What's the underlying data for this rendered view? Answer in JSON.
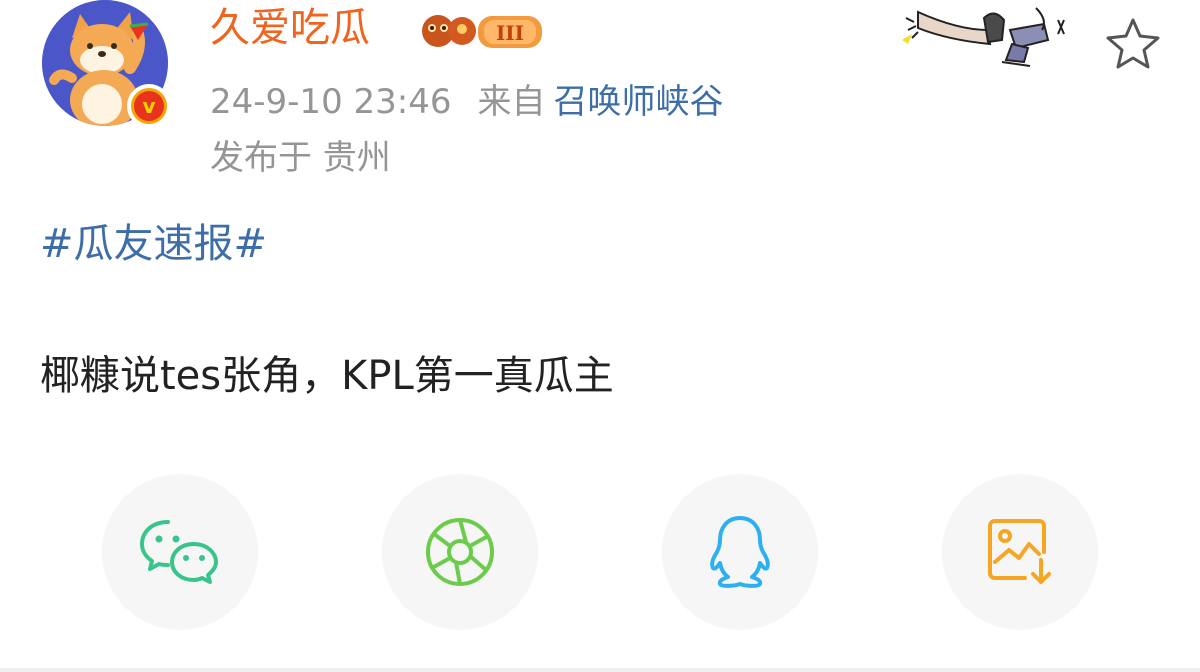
{
  "post": {
    "username": "久爱吃瓜",
    "timestamp": "24-9-10 23:46",
    "source_label": "来自",
    "source": "召唤师峡谷",
    "location": "发布于 贵州",
    "hashtag": "#瓜友速报#",
    "text": "椰糠说tes张角，KPL第一真瓜主"
  },
  "share_buttons": [
    {
      "icon": "wechat-icon",
      "color": "#38c48a"
    },
    {
      "icon": "moments-aperture-icon",
      "color": "#6ccb4a"
    },
    {
      "icon": "qq-icon",
      "color": "#2eb0f0"
    },
    {
      "icon": "save-image-icon",
      "color": "#f5a623"
    }
  ],
  "colors": {
    "username": "#f0641e",
    "link": "#3d6ea8",
    "meta": "#959595",
    "text": "#222222",
    "avatar_bg": "#4b57c9"
  }
}
